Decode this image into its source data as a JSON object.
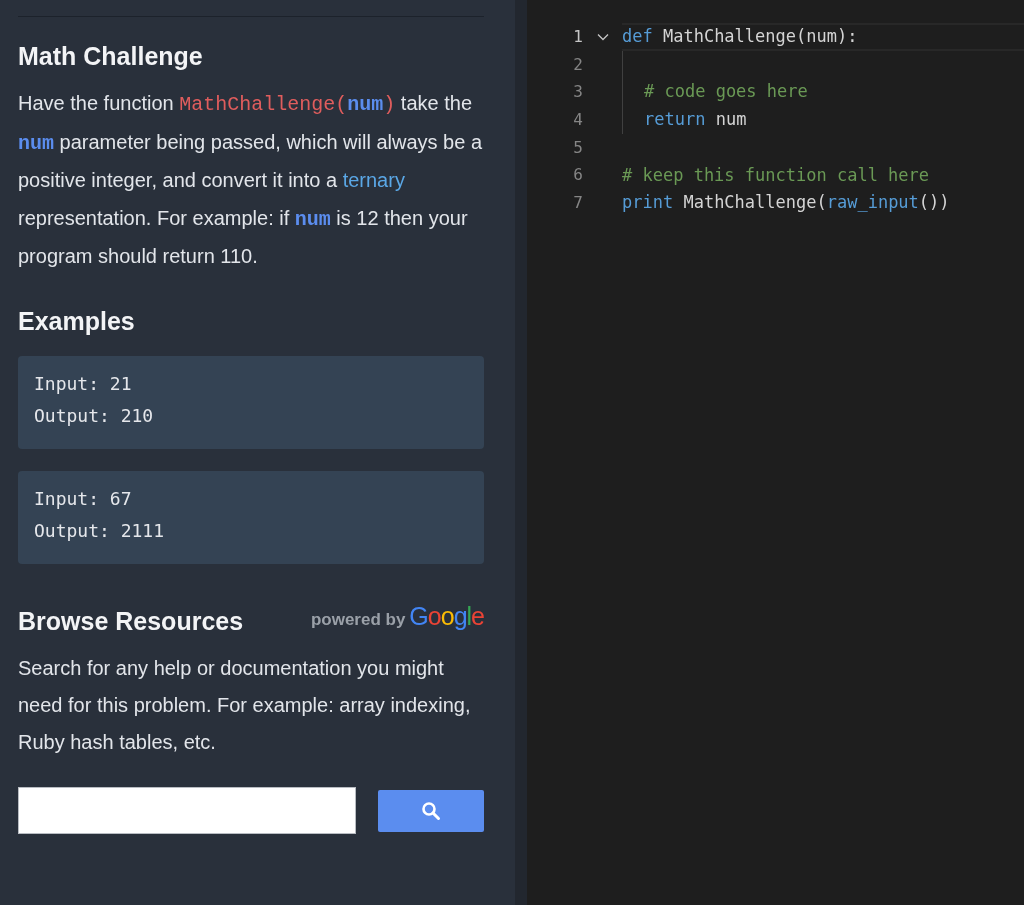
{
  "problem": {
    "title": "Math Challenge",
    "description": [
      {
        "kind": "text",
        "text": "Have the function "
      },
      {
        "kind": "code-fn",
        "text": "MathChallenge("
      },
      {
        "kind": "code-param",
        "text": "num"
      },
      {
        "kind": "code-fn",
        "text": ")"
      },
      {
        "kind": "text",
        "text": " take the "
      },
      {
        "kind": "code-param",
        "text": "num"
      },
      {
        "kind": "text",
        "text": " parameter being passed, which will always be a positive integer, and convert it into a "
      },
      {
        "kind": "link",
        "text": "ternary"
      },
      {
        "kind": "text",
        "text": " representation. For example: if "
      },
      {
        "kind": "code-param",
        "text": "num"
      },
      {
        "kind": "text",
        "text": " is 12 then your program should return 110."
      }
    ]
  },
  "examples": {
    "title": "Examples",
    "items": [
      {
        "input": "Input: 21",
        "output": "Output: 210"
      },
      {
        "input": "Input: 67",
        "output": "Output: 2111"
      }
    ]
  },
  "resources": {
    "title": "Browse Resources",
    "powered_by": "powered by",
    "logo": "Google",
    "text": "Search for any help or documentation you might need for this problem. For example: array indexing, Ruby hash tables, etc."
  },
  "editor": {
    "lines": [
      {
        "number": "1",
        "foldable": true,
        "current": true,
        "guide": false,
        "tokens": [
          {
            "kind": "keyword",
            "text": "def"
          },
          {
            "kind": "plain",
            "text": " MathChallenge(num):"
          }
        ]
      },
      {
        "number": "2",
        "foldable": false,
        "current": false,
        "guide": true
      },
      {
        "number": "3",
        "foldable": false,
        "current": false,
        "guide": true,
        "tokens": [
          {
            "kind": "comment",
            "text": "# code goes here"
          }
        ]
      },
      {
        "number": "4",
        "foldable": false,
        "current": false,
        "guide": true,
        "tokens": [
          {
            "kind": "keyword",
            "text": "return"
          },
          {
            "kind": "plain",
            "text": " num"
          }
        ]
      },
      {
        "number": "5",
        "foldable": false,
        "current": false,
        "guide": false
      },
      {
        "number": "6",
        "foldable": false,
        "current": false,
        "guide": false,
        "tokens": [
          {
            "kind": "comment",
            "text": "# keep this function call here"
          }
        ]
      },
      {
        "number": "7",
        "foldable": false,
        "current": false,
        "guide": false,
        "tokens": [
          {
            "kind": "keyword",
            "text": "print"
          },
          {
            "kind": "plain",
            "text": " MathChallenge("
          },
          {
            "kind": "keyword",
            "text": "raw_input"
          },
          {
            "kind": "plain",
            "text": "())"
          }
        ]
      }
    ]
  }
}
